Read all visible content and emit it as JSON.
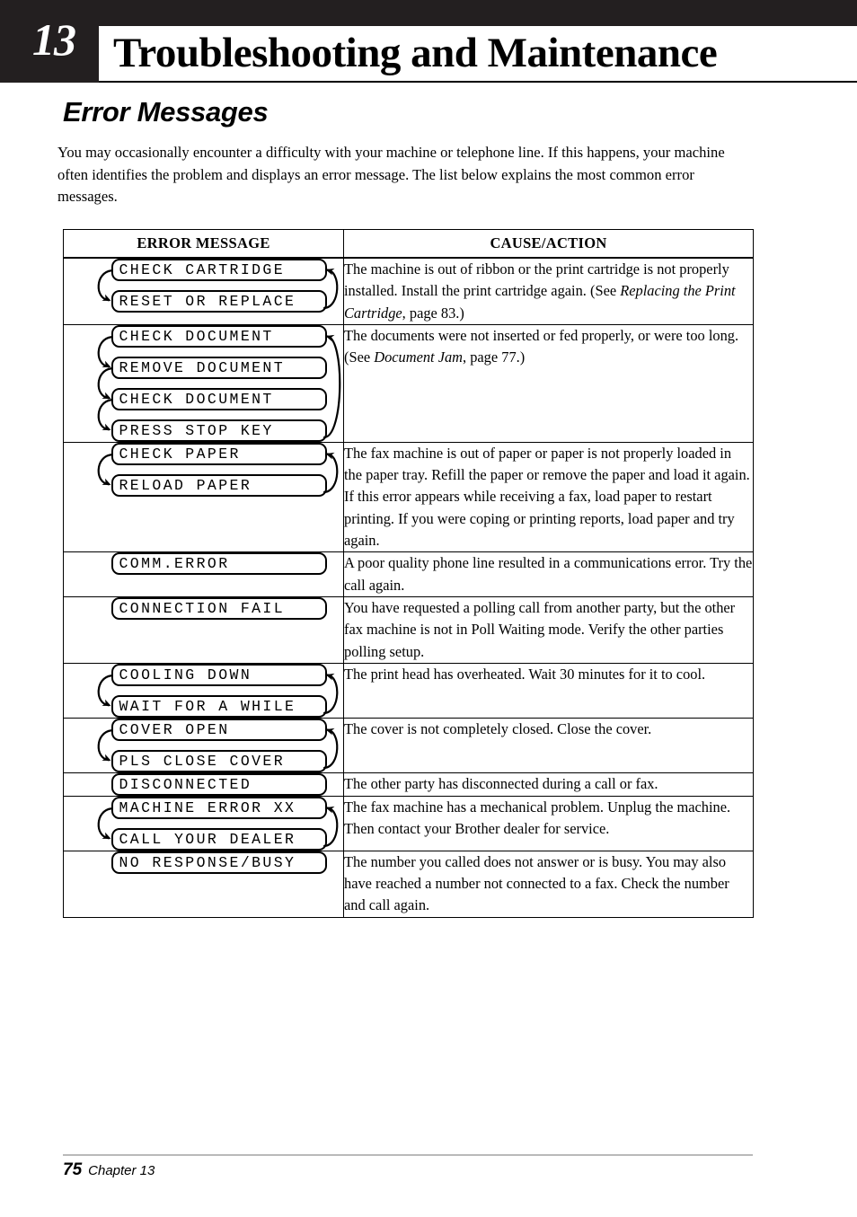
{
  "chapter": {
    "number": "13",
    "title": "Troubleshooting and Maintenance"
  },
  "section": {
    "heading": "Error Messages",
    "intro": "You may occasionally encounter a difficulty with your machine or telephone line. If this happens, your machine often identifies the problem and displays an error message. The list below explains the most common error messages."
  },
  "table": {
    "headers": {
      "message": "ERROR MESSAGE",
      "cause": "CAUSE/ACTION"
    },
    "rows": [
      {
        "messages": [
          "CHECK CARTRIDGE",
          "RESET OR REPLACE"
        ],
        "cycle": true,
        "cause_parts": [
          {
            "text": "The machine is out of ribbon or the print cartridge is not properly installed. Install the print cartridge again. (See ",
            "italic": false
          },
          {
            "text": "Replacing the Print Cartridge",
            "italic": true
          },
          {
            "text": ", page 83.)",
            "italic": false
          }
        ]
      },
      {
        "messages": [
          "CHECK DOCUMENT",
          "REMOVE DOCUMENT",
          "CHECK DOCUMENT",
          "PRESS STOP KEY"
        ],
        "cycle": true,
        "cause_parts": [
          {
            "text": "The documents were not inserted or fed properly, or were too long. (See ",
            "italic": false
          },
          {
            "text": "Document Jam",
            "italic": true
          },
          {
            "text": ", page 77.)",
            "italic": false
          }
        ]
      },
      {
        "messages": [
          "CHECK PAPER",
          "RELOAD PAPER"
        ],
        "cycle": true,
        "cause_parts": [
          {
            "text": "The fax machine is out of paper or paper is not properly loaded in the paper tray. Refill the paper or remove the paper and load it again. If this error appears while receiving a fax, load paper to restart printing. If you were coping or printing reports, load paper and try again.",
            "italic": false
          }
        ]
      },
      {
        "messages": [
          "COMM.ERROR"
        ],
        "cycle": false,
        "cause_parts": [
          {
            "text": "A poor quality phone line resulted in a communications error. Try the call again.",
            "italic": false
          }
        ]
      },
      {
        "messages": [
          "CONNECTION FAIL"
        ],
        "cycle": false,
        "cause_parts": [
          {
            "text": "You have requested a polling call from another party, but the other fax machine is not in Poll Waiting mode. Verify the other parties polling setup.",
            "italic": false
          }
        ]
      },
      {
        "messages": [
          "COOLING DOWN",
          "WAIT FOR A WHILE"
        ],
        "cycle": true,
        "cause_parts": [
          {
            "text": "The print head has overheated. Wait 30 minutes for it to cool.",
            "italic": false
          }
        ]
      },
      {
        "messages": [
          "COVER OPEN",
          "PLS CLOSE COVER"
        ],
        "cycle": true,
        "cause_parts": [
          {
            "text": "The cover is not completely closed. Close the cover.",
            "italic": false
          }
        ]
      },
      {
        "messages": [
          "DISCONNECTED"
        ],
        "cycle": false,
        "cause_parts": [
          {
            "text": "The other party has disconnected during a call or fax.",
            "italic": false
          }
        ]
      },
      {
        "messages": [
          "MACHINE ERROR XX",
          "CALL YOUR DEALER"
        ],
        "cycle": true,
        "cause_parts": [
          {
            "text": "The fax machine has a mechanical problem. Unplug the machine. Then contact your Brother dealer for service.",
            "italic": false
          }
        ]
      },
      {
        "messages": [
          "NO RESPONSE/BUSY"
        ],
        "cycle": false,
        "cause_parts": [
          {
            "text": "The number you called does not answer or is busy. You may also have reached a number not connected to a fax. Check the number and call again.",
            "italic": false
          }
        ]
      }
    ]
  },
  "footer": {
    "page_number": "75",
    "chapter_label": "Chapter 13"
  },
  "colors": {
    "banner_background": "#231f20",
    "text": "#000000",
    "footer_rule": "#b9b9b9"
  }
}
